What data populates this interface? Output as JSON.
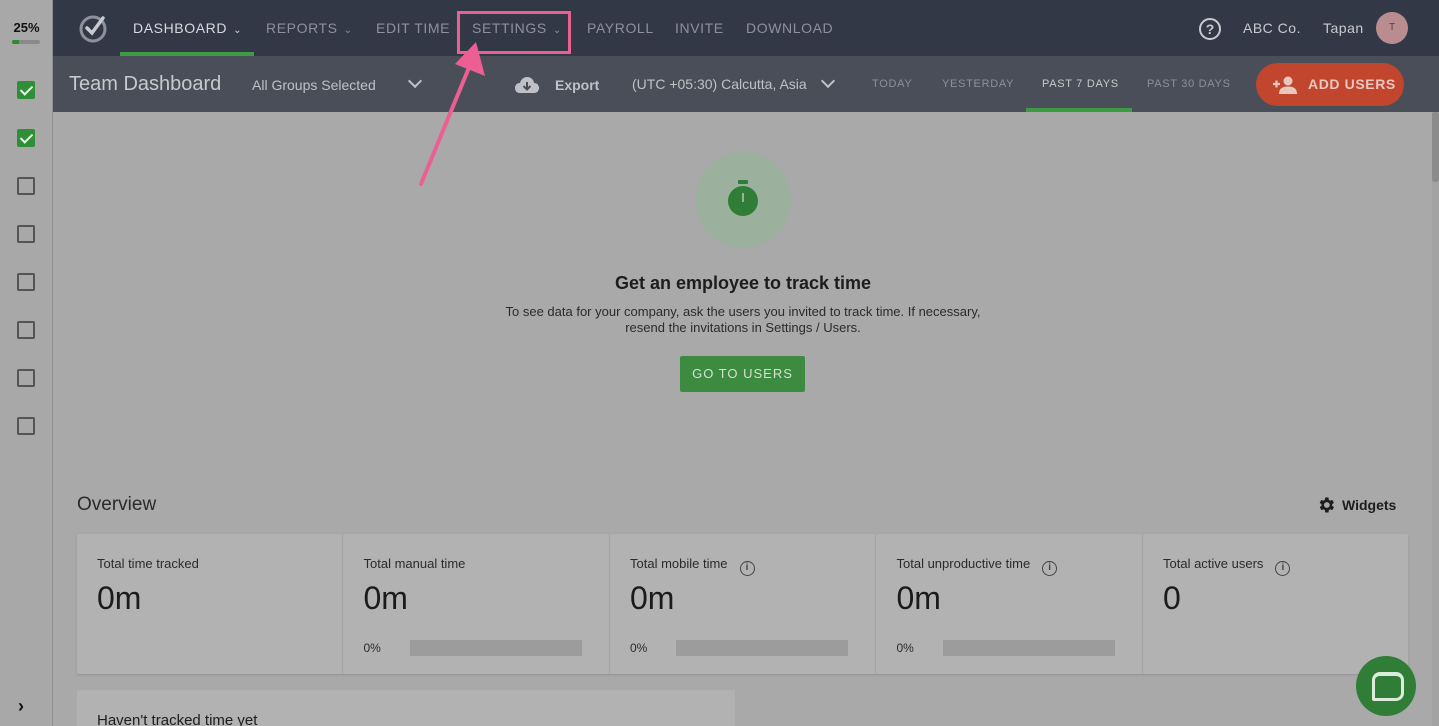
{
  "progress": {
    "label": "25%",
    "value": 0.25
  },
  "checklist": [
    {
      "checked": true
    },
    {
      "checked": true
    },
    {
      "checked": false
    },
    {
      "checked": false
    },
    {
      "checked": false
    },
    {
      "checked": false
    },
    {
      "checked": false
    },
    {
      "checked": false
    }
  ],
  "nav": {
    "items": [
      {
        "label": "DASHBOARD",
        "has_menu": true,
        "active": true
      },
      {
        "label": "REPORTS",
        "has_menu": true,
        "active": false
      },
      {
        "label": "EDIT TIME",
        "has_menu": false,
        "active": false
      },
      {
        "label": "SETTINGS",
        "has_menu": true,
        "active": false
      },
      {
        "label": "PAYROLL",
        "has_menu": false,
        "active": false
      },
      {
        "label": "INVITE",
        "has_menu": false,
        "active": false
      },
      {
        "label": "DOWNLOAD",
        "has_menu": false,
        "active": false
      }
    ],
    "help_icon": "question-circle-icon",
    "company": "ABC Co.",
    "user_name": "Tapan",
    "avatar_initial": "T"
  },
  "subheader": {
    "title": "Team Dashboard",
    "groups": "All Groups Selected",
    "export": "Export",
    "timezone": "(UTC +05:30) Calcutta, Asia",
    "ranges": [
      "TODAY",
      "YESTERDAY",
      "PAST 7 DAYS",
      "PAST 30 DAYS"
    ],
    "active_range": "PAST 7 DAYS",
    "add_users": "ADD USERS"
  },
  "empty_state": {
    "icon": "stopwatch-icon",
    "title": "Get an employee to track time",
    "description_line1": "To see data for your company, ask the users you invited to track time. If necessary,",
    "description_line2": "resend the invitations in Settings / Users.",
    "button": "GO TO USERS"
  },
  "overview": {
    "title": "Overview",
    "widgets": "Widgets",
    "cards": [
      {
        "label": "Total time tracked",
        "value": "0m",
        "info": false,
        "percent": ""
      },
      {
        "label": "Total manual time",
        "value": "0m",
        "info": false,
        "percent": "0%"
      },
      {
        "label": "Total mobile time",
        "value": "0m",
        "info": true,
        "percent": "0%"
      },
      {
        "label": "Total unproductive time",
        "value": "0m",
        "info": true,
        "percent": "0%"
      },
      {
        "label": "Total active users",
        "value": "0",
        "info": true,
        "percent": ""
      }
    ]
  },
  "untracked_title": "Haven't tracked time yet",
  "colors": {
    "accent_green": "#3f9a45",
    "add_users_red": "#c2452e",
    "highlight_pink": "#ec5f92"
  }
}
